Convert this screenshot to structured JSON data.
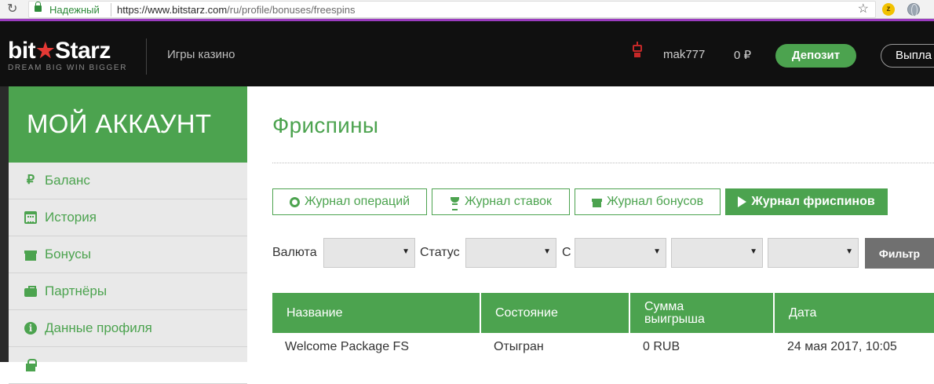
{
  "browser": {
    "secure_label": "Надежный",
    "url_host": "https://www.bitstarz.com",
    "url_path": "/ru/profile/bonuses/freespins"
  },
  "header": {
    "logo_left": "bit",
    "logo_right": "Starz",
    "logo_tagline": "DREAM BIG  WIN BIGGER",
    "nav_games": "Игры казино",
    "username": "mak777",
    "balance": "0 ₽",
    "deposit_label": "Депозит",
    "withdraw_label": "Выпла"
  },
  "sidebar": {
    "title": "МОЙ АККАУНТ",
    "items": [
      {
        "label": "Баланс",
        "icon": "ruble-icon"
      },
      {
        "label": "История",
        "icon": "calendar-icon"
      },
      {
        "label": "Бонусы",
        "icon": "gift-icon"
      },
      {
        "label": "Партнёры",
        "icon": "briefcase-icon"
      },
      {
        "label": "Данные профиля",
        "icon": "info-icon"
      },
      {
        "label": "",
        "icon": "lock-icon"
      }
    ]
  },
  "main": {
    "title": "Фриспины",
    "tabs": [
      {
        "label": "Журнал операций",
        "icon": "gear-icon",
        "active": false
      },
      {
        "label": "Журнал ставок",
        "icon": "trophy-icon",
        "active": false
      },
      {
        "label": "Журнал бонусов",
        "icon": "gift-icon",
        "active": false
      },
      {
        "label": "Журнал фриспинов",
        "icon": "play-icon",
        "active": true
      }
    ],
    "filters": {
      "currency_label": "Валюта",
      "status_label": "Статус",
      "from_label": "С",
      "currency_value": "",
      "status_value": "",
      "date_day": "",
      "date_month": "",
      "date_year": "",
      "filter_button": "Фильтр"
    },
    "table": {
      "columns": [
        "Название",
        "Состояние",
        "Сумма выигрыша",
        "Дата"
      ],
      "rows": [
        [
          "Welcome Package FS",
          "Отыгран",
          "0 RUB",
          "24 мая 2017, 10:05"
        ]
      ]
    }
  },
  "colors": {
    "brand_green": "#4ca34f",
    "header_bg": "#101010",
    "logo_star": "#e53935",
    "browser_accent": "#9b3cbf"
  }
}
